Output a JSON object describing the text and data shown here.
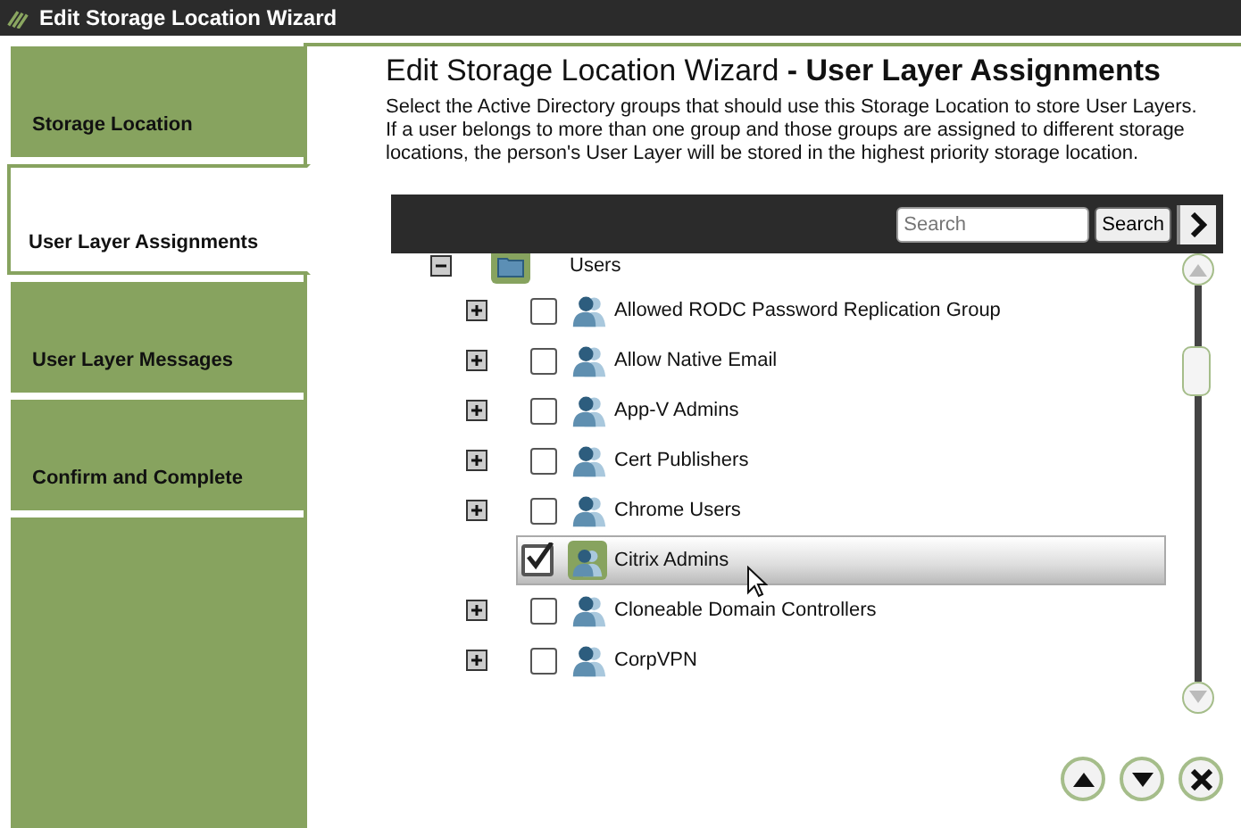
{
  "window": {
    "title": "Edit Storage Location Wizard"
  },
  "steps": [
    {
      "label": "Storage Location",
      "selected": false
    },
    {
      "label": "User Layer Assignments",
      "selected": true
    },
    {
      "label": "User Layer Messages",
      "selected": false
    },
    {
      "label": "Confirm and Complete",
      "selected": false
    }
  ],
  "heading": {
    "title": "Edit Storage Location Wizard",
    "subtitle": "- User Layer Assignments"
  },
  "description": "Select the Active Directory groups that should use this Storage Location to store User Layers. If a user belongs to more than one group and those groups are assigned to different storage locations, the person's User Layer will be stored in the highest priority storage location.",
  "search": {
    "placeholder": "Search",
    "button": "Search"
  },
  "tree": {
    "label": "Users",
    "expanded": true,
    "children": [
      {
        "label": "Allowed RODC Password Replication Group",
        "checked": false,
        "selected": false
      },
      {
        "label": "Allow Native Email",
        "checked": false,
        "selected": false
      },
      {
        "label": "App-V Admins",
        "checked": false,
        "selected": false
      },
      {
        "label": "Cert Publishers",
        "checked": false,
        "selected": false
      },
      {
        "label": "Chrome Users",
        "checked": false,
        "selected": false
      },
      {
        "label": "Citrix Admins",
        "checked": true,
        "selected": true
      },
      {
        "label": "Cloneable Domain Controllers",
        "checked": false,
        "selected": false
      },
      {
        "label": "CorpVPN",
        "checked": false,
        "selected": false
      }
    ]
  }
}
